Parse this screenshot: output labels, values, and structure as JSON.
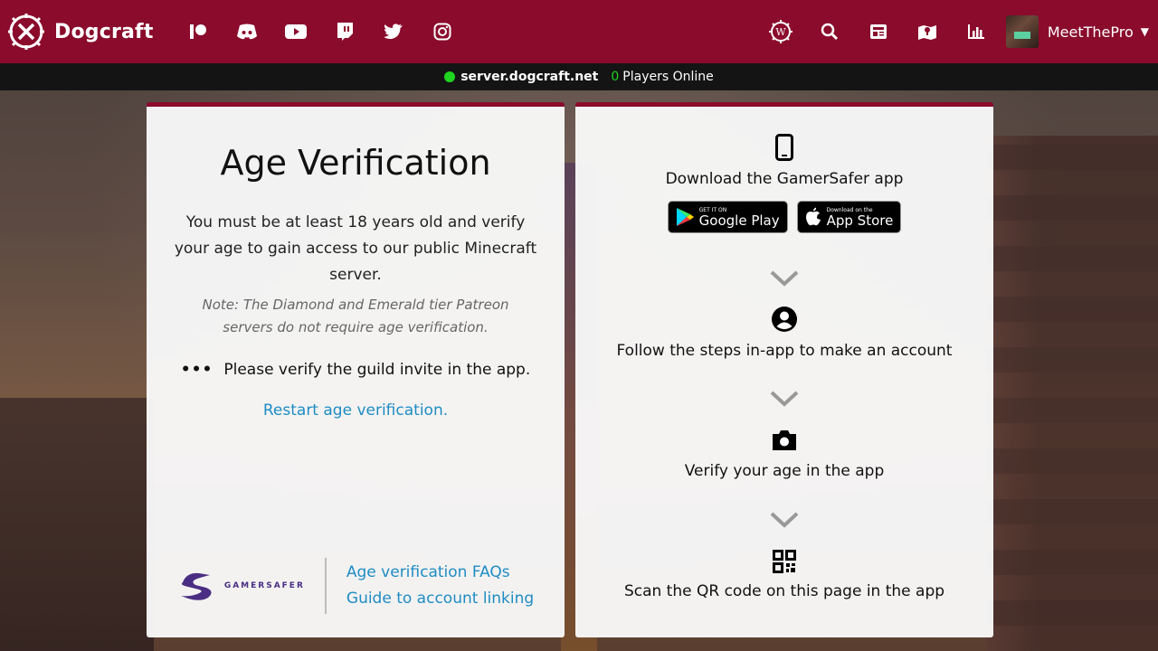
{
  "nav": {
    "brand": "Dogcraft",
    "social": [
      "patreon-icon",
      "discord-icon",
      "youtube-icon",
      "twitch-icon",
      "twitter-icon",
      "instagram-icon"
    ],
    "right_icons": [
      "wiki-icon",
      "search-icon",
      "news-icon",
      "map-icon",
      "stats-icon"
    ],
    "username": "MeetThePro",
    "accent": "#8a0b2c"
  },
  "status": {
    "server": "server.dogcraft.net",
    "players_count": "0",
    "players_label": "Players Online"
  },
  "left": {
    "title": "Age Verification",
    "description": "You must be at least 18 years old and verify your age to gain access to our public Minecraft server.",
    "note": "Note: The Diamond and Emerald tier Patreon servers do not require age verification.",
    "status_dots": "•••",
    "status_text": "Please verify the guild invite in the app.",
    "restart_link": "Restart age verification.",
    "gamersafer_text": "GAMERSAFER",
    "faq_link": "Age verification FAQs",
    "guide_link": "Guide to account linking"
  },
  "right": {
    "steps": [
      {
        "label": "Download the GamerSafer app",
        "icon": "phone-icon"
      },
      {
        "label": "Follow the steps in-app to make an account",
        "icon": "user-icon"
      },
      {
        "label": "Verify your age in the app",
        "icon": "camera-icon"
      },
      {
        "label": "Scan the QR code on this page in the app",
        "icon": "qr-code-icon"
      }
    ],
    "google_play_small": "GET IT ON",
    "google_play_big": "Google Play",
    "app_store_small": "Download on the",
    "app_store_big": "App Store"
  }
}
